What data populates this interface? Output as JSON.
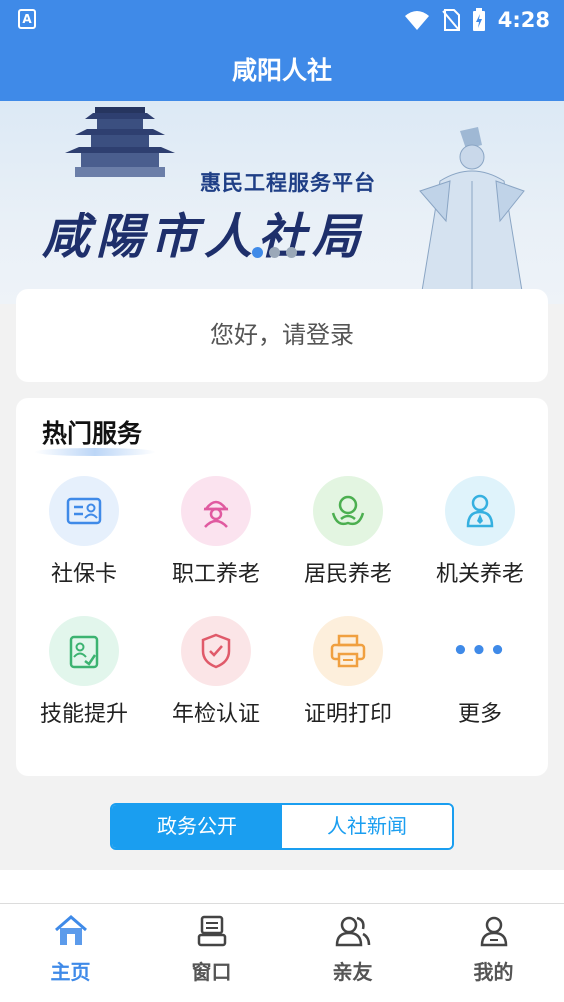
{
  "status_bar": {
    "time": "4:28",
    "app_badge": "A"
  },
  "header": {
    "title": "咸阳人社"
  },
  "banner": {
    "subtitle": "惠民工程服务平台",
    "title": "咸陽市人社局",
    "slide_count": 3,
    "active_slide": 1
  },
  "login": {
    "prompt": "您好，请登录"
  },
  "hot_services": {
    "title": "热门服务",
    "items": [
      {
        "label": "社保卡",
        "icon": "social-card-icon",
        "color": "#3f8ae8",
        "bg": "#e6f0fc"
      },
      {
        "label": "职工养老",
        "icon": "worker-helmet-icon",
        "color": "#e05aa0",
        "bg": "#fbe3ef"
      },
      {
        "label": "居民养老",
        "icon": "resident-hands-icon",
        "color": "#4caf50",
        "bg": "#e3f5e1"
      },
      {
        "label": "机关养老",
        "icon": "official-person-icon",
        "color": "#35b0e0",
        "bg": "#dff3fb"
      },
      {
        "label": "技能提升",
        "icon": "skill-clipboard-icon",
        "color": "#3cb371",
        "bg": "#e2f6ec"
      },
      {
        "label": "年检认证",
        "icon": "shield-check-icon",
        "color": "#e05a6a",
        "bg": "#fbe5e7"
      },
      {
        "label": "证明打印",
        "icon": "printer-icon",
        "color": "#f0a040",
        "bg": "#fdefdc"
      },
      {
        "label": "更多",
        "icon": "more-dots-icon",
        "color": "#3f8ae8",
        "bg": "#ffffff"
      }
    ]
  },
  "segment": {
    "tabs": [
      {
        "label": "政务公开",
        "active": true
      },
      {
        "label": "人社新闻",
        "active": false
      }
    ]
  },
  "tabbar": {
    "items": [
      {
        "label": "主页",
        "icon": "home-icon",
        "active": true
      },
      {
        "label": "窗口",
        "icon": "window-counter-icon",
        "active": false
      },
      {
        "label": "亲友",
        "icon": "friends-icon",
        "active": false
      },
      {
        "label": "我的",
        "icon": "profile-icon",
        "active": false
      }
    ]
  },
  "colors": {
    "primary": "#3f8ae8",
    "segment_accent": "#1a9ef0"
  }
}
